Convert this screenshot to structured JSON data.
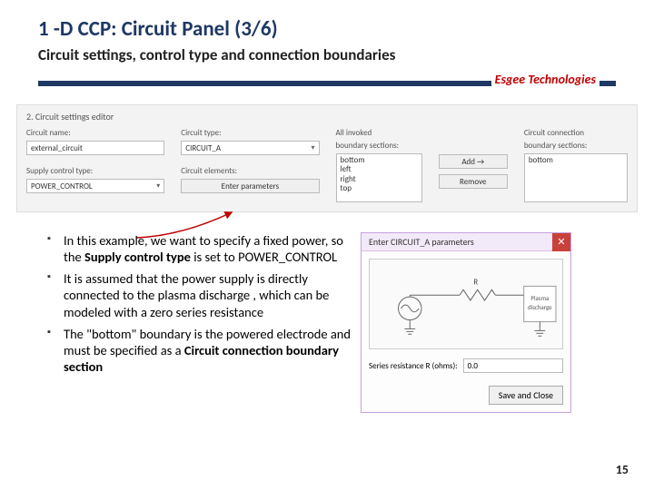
{
  "title": "1 -D CCP: Circuit Panel (3/6)",
  "subtitle": "Circuit settings, control type and connection boundaries",
  "brand": "Esgee Technologies",
  "editor": {
    "heading": "2. Circuit settings editor",
    "circuit_name_label": "Circuit name:",
    "circuit_name_value": "external_circuit",
    "supply_control_label": "Supply control type:",
    "supply_control_value": "POWER_CONTROL",
    "circuit_type_label": "Circuit type:",
    "circuit_type_value": "CIRCUIT_A",
    "circuit_elements_label": "Circuit elements:",
    "enter_params_btn": "Enter parameters",
    "invoked_label_line1": "All invoked",
    "invoked_label_line2": "boundary sections:",
    "invoked_items": [
      "bottom",
      "left",
      "right",
      "top"
    ],
    "add_btn": "Add →",
    "remove_btn": "Remove",
    "conn_label_line1": "Circuit connection",
    "conn_label_line2": "boundary sections:",
    "conn_items": [
      "bottom"
    ]
  },
  "bullets": {
    "b1_pre": "In this example, we want to specify a fixed power, so the ",
    "b1_bold": "Supply control type",
    "b1_post": " is set to POWER_CONTROL",
    "b2": "It is assumed that the power supply is directly connected to the plasma discharge , which can be modeled with a zero series resistance",
    "b3_pre": "The \"bottom\" boundary is the powered electrode and must be specified as a ",
    "b3_bold": "Circuit connection boundary section"
  },
  "dialog": {
    "title": "Enter CIRCUIT_A parameters",
    "close": "✕",
    "res_label_text": "R",
    "plasma_label_l1": "Plasma",
    "plasma_label_l2": "discharge",
    "param_label": "Series resistance R (ohms):",
    "param_value": "0.0",
    "save_btn": "Save and Close"
  },
  "page": "15"
}
